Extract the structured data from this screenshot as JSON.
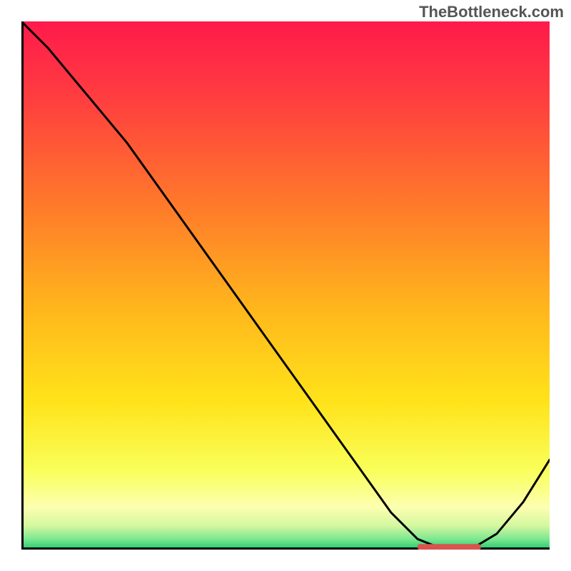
{
  "watermark": "TheBottleneck.com",
  "chart_data": {
    "type": "line",
    "title": "",
    "xlabel": "",
    "ylabel": "",
    "xlim": [
      0,
      100
    ],
    "ylim": [
      0,
      100
    ],
    "grid": false,
    "series": [
      {
        "name": "curve",
        "x": [
          0,
          5,
          10,
          15,
          20,
          25,
          30,
          35,
          40,
          45,
          50,
          55,
          60,
          65,
          70,
          75,
          80,
          85,
          90,
          95,
          100
        ],
        "y": [
          100,
          95,
          89,
          83,
          77,
          70,
          63,
          56,
          49,
          42,
          35,
          28,
          21,
          14,
          7,
          2,
          0,
          0,
          3,
          9,
          17
        ]
      }
    ],
    "background_gradient": {
      "stops": [
        {
          "offset": 0.0,
          "color": "#ff1a4b"
        },
        {
          "offset": 0.15,
          "color": "#ff3f3f"
        },
        {
          "offset": 0.35,
          "color": "#ff7a2a"
        },
        {
          "offset": 0.55,
          "color": "#ffb81c"
        },
        {
          "offset": 0.72,
          "color": "#ffe31a"
        },
        {
          "offset": 0.85,
          "color": "#f9ff5a"
        },
        {
          "offset": 0.92,
          "color": "#fcffb0"
        },
        {
          "offset": 0.955,
          "color": "#d4f7a0"
        },
        {
          "offset": 0.98,
          "color": "#7de890"
        },
        {
          "offset": 1.0,
          "color": "#22c96a"
        }
      ]
    },
    "marker_bar": {
      "x_start": 75,
      "x_end": 87,
      "y": 0.5,
      "color": "#d9534f"
    },
    "axis_color": "#000000",
    "line_color": "#000000",
    "line_width": 3
  }
}
